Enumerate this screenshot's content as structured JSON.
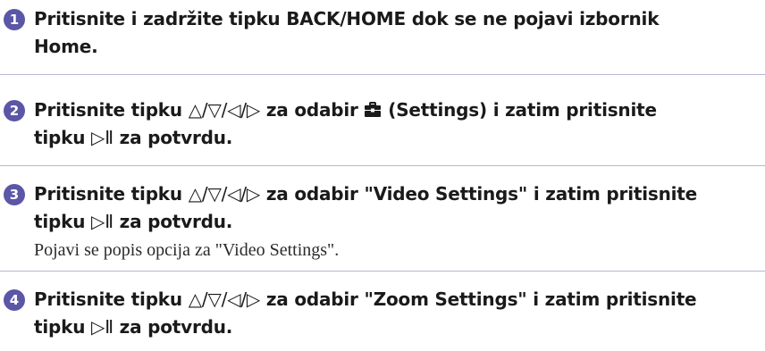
{
  "steps": [
    {
      "number": "1",
      "title_line1": "Pritisnite i zadržite tipku BACK/HOME dok se ne pojavi izbornik",
      "title_line2": "Home."
    },
    {
      "number": "2",
      "title_prefix": "Pritisnite tipku ",
      "nav_buttons": "△/▽/◁/▷",
      "title_mid": " za odabir ",
      "icon": "toolbox-icon",
      "title_suffix": " (Settings) i zatim pritisnite",
      "title_line2_prefix": "tipku ",
      "play_button": "▷Ⅱ",
      "title_line2_suffix": " za potvrdu."
    },
    {
      "number": "3",
      "title_prefix": "Pritisnite tipku ",
      "nav_buttons": "△/▽/◁/▷",
      "title_suffix": " za odabir \"Video Settings\" i zatim pritisnite",
      "title_line2_prefix": "tipku ",
      "play_button": "▷Ⅱ",
      "title_line2_suffix": " za potvrdu.",
      "description": "Pojavi se popis opcija za \"Video Settings\"."
    },
    {
      "number": "4",
      "title_prefix": "Pritisnite tipku ",
      "nav_buttons": "△/▽/◁/▷",
      "title_suffix": " za odabir \"Zoom Settings\" i zatim pritisnite",
      "title_line2_prefix": "tipku ",
      "play_button": "▷Ⅱ",
      "title_line2_suffix": " za potvrdu."
    }
  ],
  "colors": {
    "step_number_bg": "#5b57a6",
    "divider": "#b9b6d6",
    "text": "#1a1a1a"
  }
}
